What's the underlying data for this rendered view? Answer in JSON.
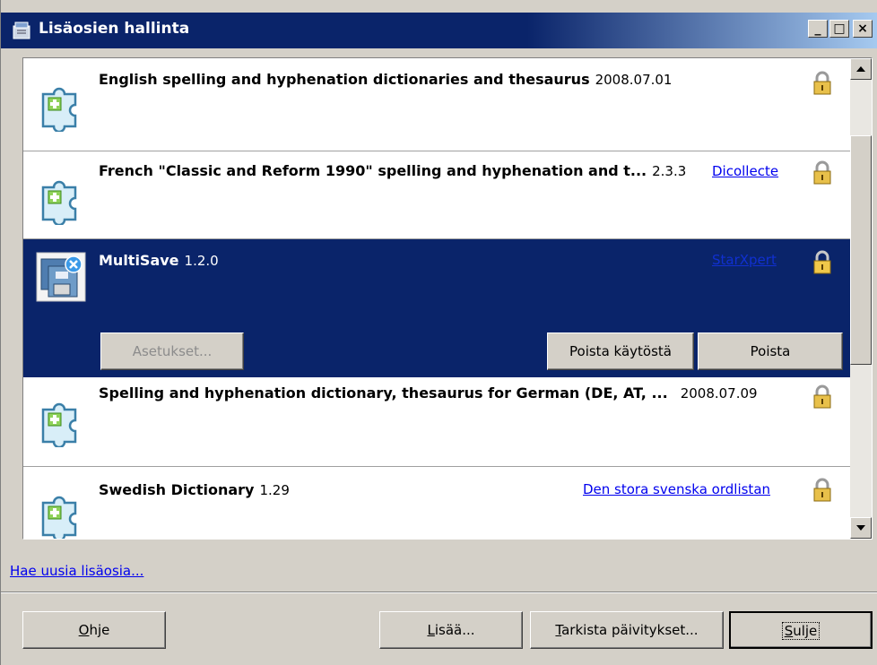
{
  "window": {
    "title": "Lisäosien hallinta",
    "controls": {
      "minimize": "_",
      "maximize": "□",
      "close": "×"
    }
  },
  "addons": [
    {
      "name": "English spelling and hyphenation dictionaries and thesaurus",
      "version": "2008.07.01",
      "link": "",
      "icon": "puzzle-icon",
      "locked": true
    },
    {
      "name": "French \"Classic and Reform 1990\" spelling and hyphenation and t...",
      "version": "2.3.3",
      "link": "Dicollecte",
      "icon": "puzzle-icon",
      "locked": true
    },
    {
      "name": "MultiSave",
      "version": "1.2.0",
      "link": "StarXpert",
      "icon": "multisave-icon",
      "locked": true,
      "selected": true,
      "buttons": {
        "options": "Asetukset...",
        "disable": "Poista käytöstä",
        "remove": "Poista"
      }
    },
    {
      "name": "Spelling and hyphenation dictionary, thesaurus for German (DE, AT, ...",
      "version": "2008.07.09",
      "link": "",
      "icon": "puzzle-icon",
      "locked": true
    },
    {
      "name": "Swedish Dictionary",
      "version": "1.29",
      "link": "Den stora svenska ordlistan",
      "icon": "puzzle-icon",
      "locked": true
    }
  ],
  "get_more_link": "Hae uusia lisäosia...",
  "footer": {
    "help": {
      "mn": "O",
      "rest": "hje"
    },
    "add": {
      "mn": "L",
      "rest": "isää..."
    },
    "check_updates": {
      "mn": "T",
      "rest": "arkista päivitykset..."
    },
    "close": {
      "mn": "S",
      "rest": "ulje"
    }
  },
  "colors": {
    "selection": "#0a246a",
    "link": "#0000ee",
    "face": "#d4d0c8"
  }
}
